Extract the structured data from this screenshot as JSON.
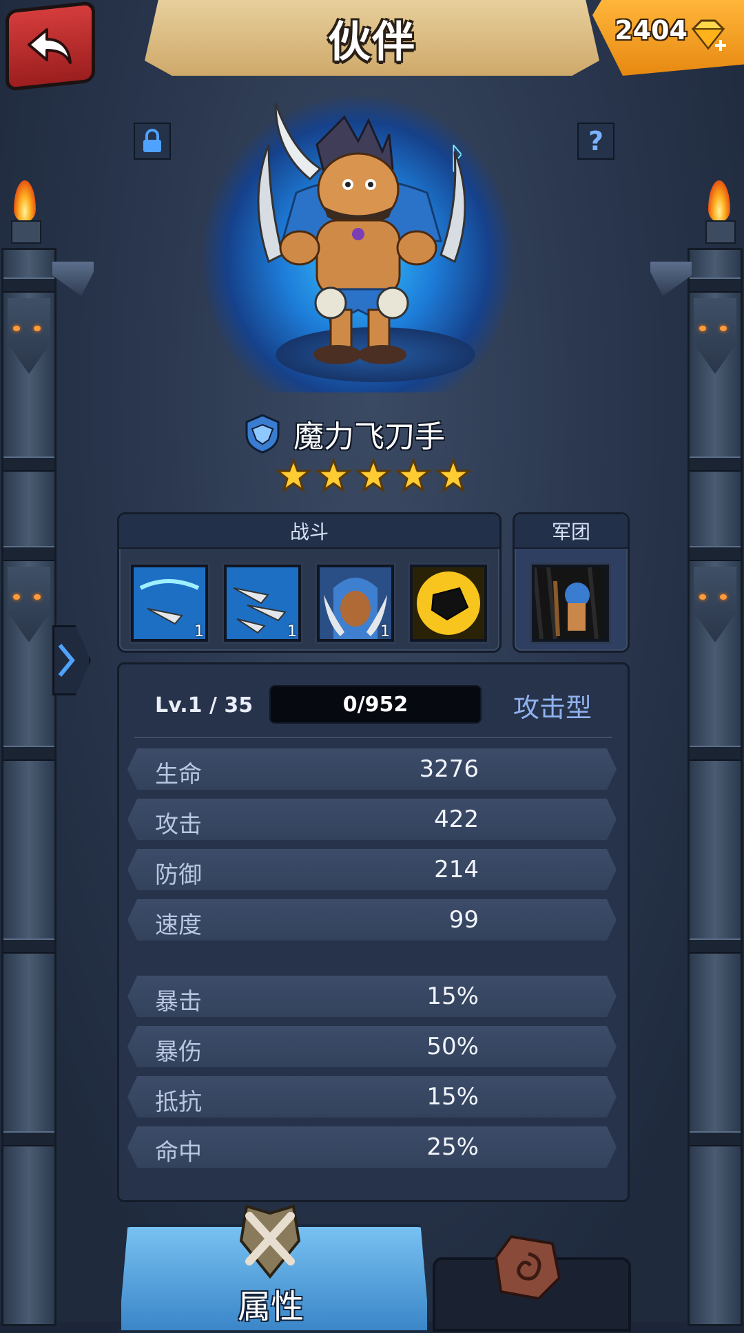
{
  "header": {
    "title": "伙伴",
    "currency_amount": "2404",
    "back_icon": "back-arrow-icon",
    "currency_icon": "gem-plus-icon"
  },
  "hero": {
    "name": "魔力飞刀手",
    "stars": 5,
    "class_icon": "class-emblem-icon"
  },
  "skills": {
    "combat_label": "战斗",
    "legion_label": "军团",
    "slots": [
      {
        "icon": "flying-blade-skill-icon",
        "level": "1"
      },
      {
        "icon": "multi-blade-skill-icon",
        "level": "1"
      },
      {
        "icon": "hooded-assassin-skill-icon",
        "level": "1"
      },
      {
        "icon": "golden-fist-skill-icon",
        "level": ""
      }
    ],
    "legion_slot": {
      "icon": "legion-shaman-icon"
    }
  },
  "level": {
    "label": "Lv.1 / 35",
    "exp_text": "0/952",
    "exp_progress": 0.0,
    "type": "攻击型"
  },
  "base_stats": [
    {
      "name": "生命",
      "value": "3276"
    },
    {
      "name": "攻击",
      "value": "422"
    },
    {
      "name": "防御",
      "value": "214"
    },
    {
      "name": "速度",
      "value": "99"
    }
  ],
  "advanced_stats": [
    {
      "name": "暴击",
      "value": "15%"
    },
    {
      "name": "暴伤",
      "value": "50%"
    },
    {
      "name": "抵抗",
      "value": "15%"
    },
    {
      "name": "命中",
      "value": "25%"
    }
  ],
  "tabs": {
    "attributes_label": "属性"
  },
  "colors": {
    "accent_blue": "#4d8ce6",
    "star_gold": "#ffcc33",
    "back_red": "#c83030",
    "currency_orange": "#f39a1e"
  }
}
